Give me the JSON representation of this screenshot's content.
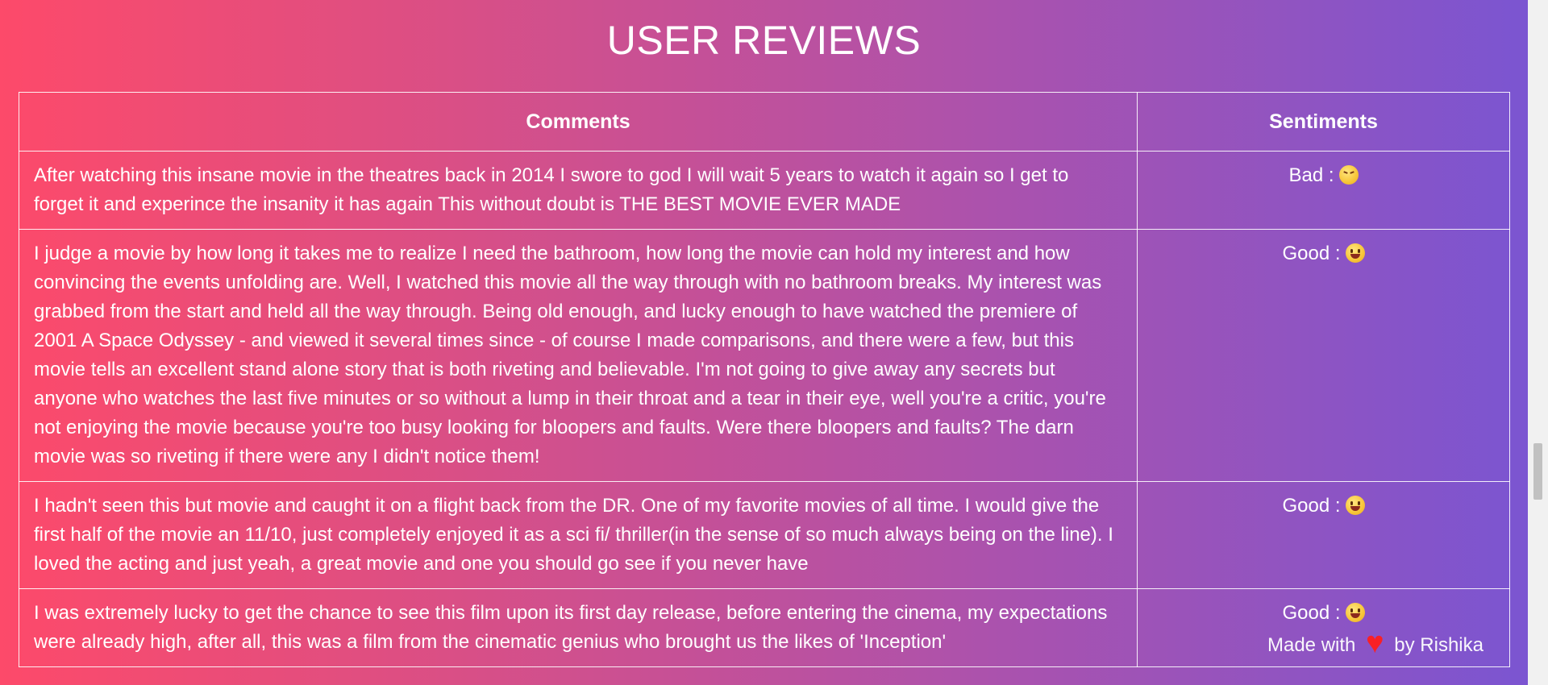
{
  "heading": "USER REVIEWS",
  "table": {
    "headers": [
      "Comments",
      "Sentiments"
    ],
    "rows": [
      {
        "comment": "After watching this insane movie in the theatres back in 2014 I swore to god I will wait 5 years to watch it again so I get to forget it and experince the insanity it has again This without doubt is THE BEST MOVIE EVER MADE",
        "sentiment": "Bad :",
        "emoji": "confounded-face-icon"
      },
      {
        "comment": "I judge a movie by how long it takes me to realize I need the bathroom, how long the movie can hold my interest and how convincing the events unfolding are. Well, I watched this movie all the way through with no bathroom breaks. My interest was grabbed from the start and held all the way through. Being old enough, and lucky enough to have watched the premiere of 2001 A Space Odyssey - and viewed it several times since - of course I made comparisons, and there were a few, but this movie tells an excellent stand alone story that is both riveting and believable. I'm not going to give away any secrets but anyone who watches the last five minutes or so without a lump in their throat and a tear in their eye, well you're a critic, you're not enjoying the movie because you're too busy looking for bloopers and faults. Were there bloopers and faults? The darn movie was so riveting if there were any I didn't notice them!",
        "sentiment": "Good :",
        "emoji": "grinning-face-icon"
      },
      {
        "comment": "I hadn't seen this but movie and caught it on a flight back from the DR. One of my favorite movies of all time. I would give the first half of the movie an 11/10, just completely enjoyed it as a sci fi/ thriller(in the sense of so much always being on the line). I loved the acting and just yeah, a great movie and one you should go see if you never have",
        "sentiment": "Good :",
        "emoji": "grinning-face-icon"
      },
      {
        "comment": "I was extremely lucky to get the chance to see this film upon its first day release, before entering the cinema, my expectations were already high, after all, this was a film from the cinematic genius who brought us the likes of 'Inception'",
        "sentiment": "Good :",
        "emoji": "grinning-face-icon"
      }
    ]
  },
  "footer": {
    "prefix": "Made with",
    "heart": "♥",
    "suffix": "by Rishika"
  }
}
